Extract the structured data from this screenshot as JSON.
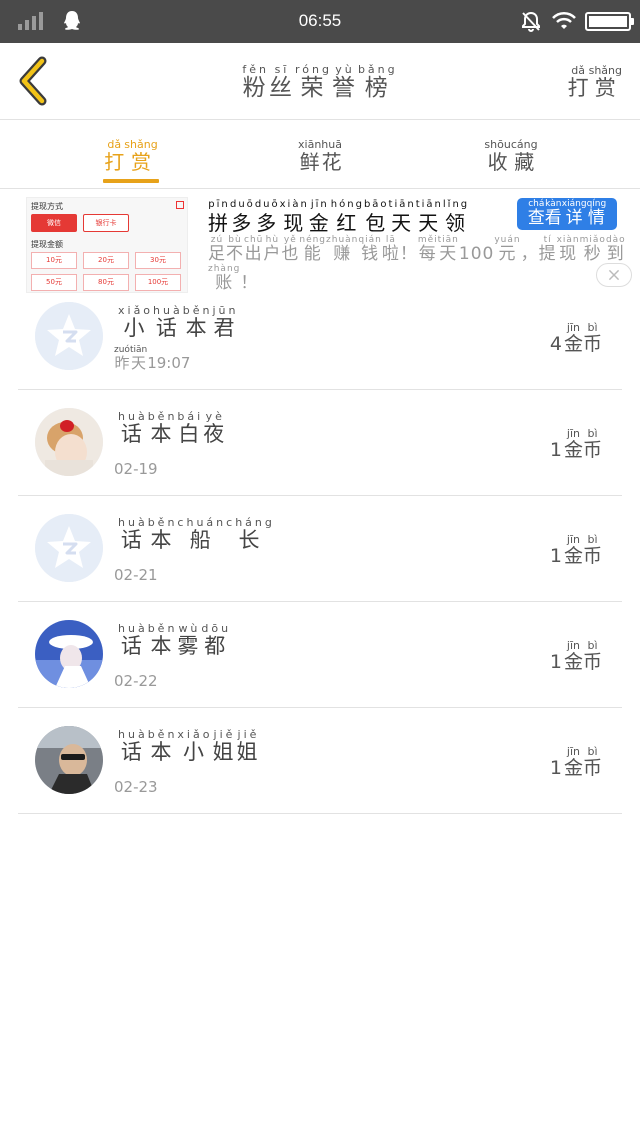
{
  "status_bar": {
    "time": "06:55"
  },
  "header": {
    "title": [
      {
        "py": "fěn",
        "hz": "粉"
      },
      {
        "py": "sī",
        "hz": "丝"
      },
      {
        "py": "róng",
        "hz": "荣"
      },
      {
        "py": "yù",
        "hz": "誉"
      },
      {
        "py": "bǎng",
        "hz": "榜"
      }
    ],
    "right": [
      {
        "py": "dǎ",
        "hz": "打"
      },
      {
        "py": "shǎng",
        "hz": "赏"
      }
    ]
  },
  "tabs": [
    {
      "label": [
        {
          "py": "dǎ",
          "hz": "打"
        },
        {
          "py": "shǎng",
          "hz": "赏"
        }
      ],
      "active": true
    },
    {
      "label": [
        {
          "py": "xiān",
          "hz": "鲜"
        },
        {
          "py": "huā",
          "hz": "花"
        }
      ],
      "active": false
    },
    {
      "label": [
        {
          "py": "shōu",
          "hz": "收"
        },
        {
          "py": "cáng",
          "hz": "藏"
        }
      ],
      "active": false
    }
  ],
  "ad": {
    "thumb": {
      "title": "提现方式",
      "wechat": "微信",
      "bank": "银行卡",
      "amount_label": "提现金额",
      "amounts": [
        "10元",
        "20元",
        "30元",
        "50元",
        "80元",
        "100元"
      ]
    },
    "title": [
      {
        "py": "pīn",
        "hz": "拼"
      },
      {
        "py": "duō",
        "hz": "多"
      },
      {
        "py": "duō",
        "hz": "多"
      },
      {
        "py": "xiàn",
        "hz": "现"
      },
      {
        "py": "jīn",
        "hz": "金"
      },
      {
        "py": "hóng",
        "hz": "红"
      },
      {
        "py": "bāo",
        "hz": "包"
      },
      {
        "py": "tiān",
        "hz": "天"
      },
      {
        "py": "tiān",
        "hz": "天"
      },
      {
        "py": "lǐng",
        "hz": "领"
      }
    ],
    "cta": [
      {
        "py": "chá",
        "hz": "查"
      },
      {
        "py": "kàn",
        "hz": "看"
      },
      {
        "py": "xiáng",
        "hz": "详"
      },
      {
        "py": "qíng",
        "hz": "情"
      }
    ],
    "desc": [
      {
        "py": "zú",
        "hz": "足"
      },
      {
        "py": "bù",
        "hz": "不"
      },
      {
        "py": "chū",
        "hz": "出"
      },
      {
        "py": "hù",
        "hz": "户"
      },
      {
        "py": "yě",
        "hz": "也"
      },
      {
        "py": "néng",
        "hz": "能"
      },
      {
        "py": "zhuàn",
        "hz": "赚"
      },
      {
        "py": "qián",
        "hz": "钱"
      },
      {
        "py": "lā",
        "hz": "啦"
      },
      {
        "py": "",
        "hz": "！"
      },
      {
        "py": "měi",
        "hz": "每"
      },
      {
        "py": "tiān",
        "hz": "天"
      },
      {
        "py": "",
        "hz": "100"
      },
      {
        "py": "yuán",
        "hz": "元"
      },
      {
        "py": "",
        "hz": "，"
      },
      {
        "py": "tí",
        "hz": "提"
      },
      {
        "py": "xiàn",
        "hz": "现"
      },
      {
        "py": "miǎo",
        "hz": "秒"
      },
      {
        "py": "dào",
        "hz": "到"
      },
      {
        "py": "zhàng",
        "hz": "账"
      },
      {
        "py": "",
        "hz": "！"
      }
    ]
  },
  "list": [
    {
      "name": [
        {
          "py": "xiǎo",
          "hz": "小"
        },
        {
          "py": "huà",
          "hz": "话"
        },
        {
          "py": "běn",
          "hz": "本"
        },
        {
          "py": "jūn",
          "hz": "君"
        }
      ],
      "time": [
        {
          "py": "zuó",
          "hz": "昨"
        },
        {
          "py": "tiān",
          "hz": "天"
        },
        {
          "py": "",
          "hz": " 19:07"
        }
      ],
      "coins": "4",
      "coin_unit": [
        {
          "py": "jīn",
          "hz": "金"
        },
        {
          "py": "bì",
          "hz": "币"
        }
      ],
      "avatar": "qq-default"
    },
    {
      "name": [
        {
          "py": "huà",
          "hz": "话"
        },
        {
          "py": "běn",
          "hz": "本"
        },
        {
          "py": "bái",
          "hz": "白"
        },
        {
          "py": "yè",
          "hz": "夜"
        }
      ],
      "time": [
        {
          "py": "",
          "hz": "02-19"
        }
      ],
      "coins": "1",
      "coin_unit": [
        {
          "py": "jīn",
          "hz": "金"
        },
        {
          "py": "bì",
          "hz": "币"
        }
      ],
      "avatar": "girl-red-bow"
    },
    {
      "name": [
        {
          "py": "huà",
          "hz": "话"
        },
        {
          "py": "běn",
          "hz": "本"
        },
        {
          "py": "chuán",
          "hz": "船"
        },
        {
          "py": "cháng",
          "hz": "长"
        }
      ],
      "time": [
        {
          "py": "",
          "hz": "02-21"
        }
      ],
      "coins": "1",
      "coin_unit": [
        {
          "py": "jīn",
          "hz": "金"
        },
        {
          "py": "bì",
          "hz": "币"
        }
      ],
      "avatar": "qq-default"
    },
    {
      "name": [
        {
          "py": "huà",
          "hz": "话"
        },
        {
          "py": "běn",
          "hz": "本"
        },
        {
          "py": "wù",
          "hz": "雾"
        },
        {
          "py": "dōu",
          "hz": "都"
        }
      ],
      "time": [
        {
          "py": "",
          "hz": "02-22"
        }
      ],
      "coins": "1",
      "coin_unit": [
        {
          "py": "jīn",
          "hz": "金"
        },
        {
          "py": "bì",
          "hz": "币"
        }
      ],
      "avatar": "anime-hat"
    },
    {
      "name": [
        {
          "py": "huà",
          "hz": "话"
        },
        {
          "py": "běn",
          "hz": "本"
        },
        {
          "py": "xiǎo",
          "hz": "小"
        },
        {
          "py": "jiě",
          "hz": "姐"
        },
        {
          "py": "jiě",
          "hz": "姐"
        }
      ],
      "time": [
        {
          "py": "",
          "hz": "02-23"
        }
      ],
      "coins": "1",
      "coin_unit": [
        {
          "py": "jīn",
          "hz": "金"
        },
        {
          "py": "bì",
          "hz": "币"
        }
      ],
      "avatar": "sunglasses-man"
    }
  ],
  "colors": {
    "accent": "#e7a21a",
    "status_bar": "#4a4a4a",
    "cta_blue": "#2f7fe6",
    "divider": "#e2e2e2"
  }
}
